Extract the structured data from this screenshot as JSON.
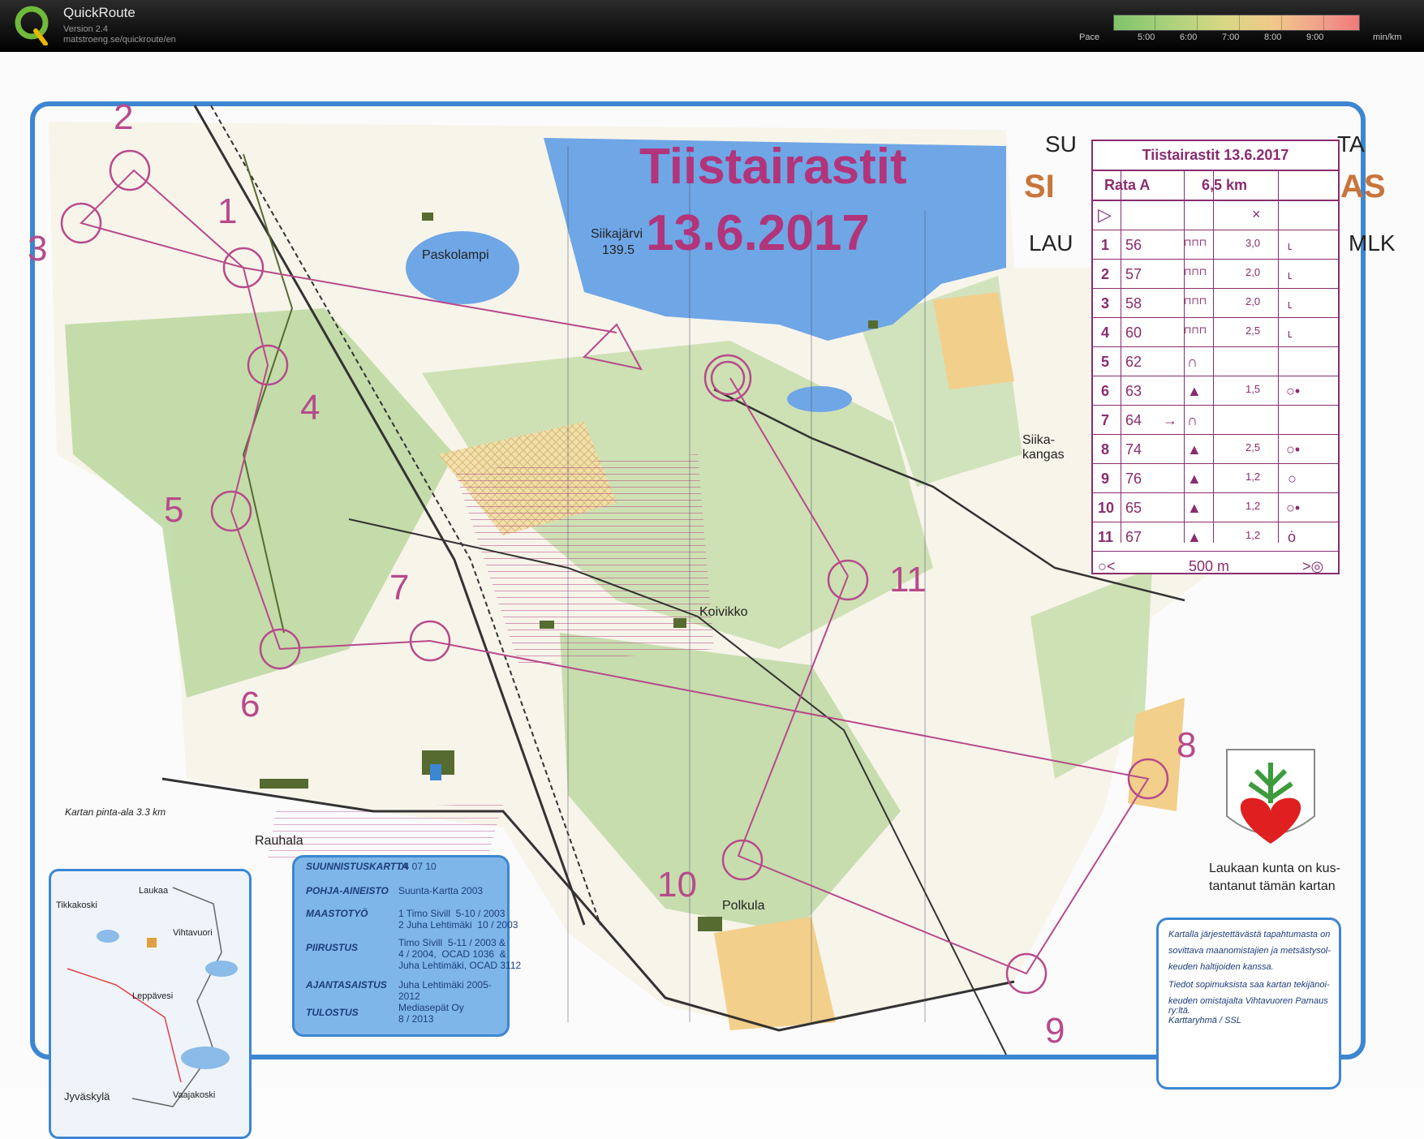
{
  "app": {
    "name": "QuickRoute",
    "version": "Version 2.4",
    "url": "matstroeng.se/quickroute/en"
  },
  "pace_legend": {
    "label": "Pace",
    "ticks": [
      "5:00",
      "6:00",
      "7:00",
      "8:00",
      "9:00"
    ],
    "unit": "min/km"
  },
  "map": {
    "title_line1": "Tiistairastit",
    "title_line2": "13.6.2017",
    "banner_partial_top": "SU",
    "banner_partial_top_right": "TA",
    "banner_partial_mid": "SI",
    "banner_partial_mid_right": "AS",
    "banner_partial_bottom": "LAU",
    "banner_partial_bottom_right": "MLK",
    "control_numbers": [
      "1",
      "2",
      "3",
      "4",
      "5",
      "6",
      "7",
      "8",
      "9",
      "10",
      "11"
    ],
    "place_names": {
      "paskolampi": "Paskolampi",
      "siikajarvi": "Siikajärvi",
      "siikajarvi_height": "139.5",
      "koivikko": "Koivikko",
      "polkula": "Polkula",
      "rauhala": "Rauhala",
      "siikakangas": "Siika-\nkangas"
    }
  },
  "control_description": {
    "title": "Tiistairastit 13.6.2017",
    "course": "Rata A",
    "length": "6,5 km",
    "rows": [
      {
        "n": "1",
        "code": "56",
        "size": "3,0"
      },
      {
        "n": "2",
        "code": "57",
        "size": "2,0"
      },
      {
        "n": "3",
        "code": "58",
        "size": "2,0"
      },
      {
        "n": "4",
        "code": "60",
        "size": "2,5"
      },
      {
        "n": "5",
        "code": "62",
        "size": ""
      },
      {
        "n": "6",
        "code": "63",
        "size": "1,5"
      },
      {
        "n": "7",
        "code": "64",
        "size": ""
      },
      {
        "n": "8",
        "code": "74",
        "size": "2,5"
      },
      {
        "n": "9",
        "code": "76",
        "size": "1,2"
      },
      {
        "n": "10",
        "code": "65",
        "size": "1,2"
      },
      {
        "n": "11",
        "code": "67",
        "size": "1,2"
      }
    ],
    "finish": "500 m"
  },
  "credits": {
    "title_key": "SUUNNISTUSKARTTA",
    "title_val": "04 07 10",
    "rows": [
      {
        "key": "POHJA-AINEISTO",
        "val": "Suunta-Kartta  2003"
      },
      {
        "key": "MAASTOTYÖ",
        "val": "1 Timo Sivill  5-10 / 2003\n2 Juha Lehtimäki  10 / 2003"
      },
      {
        "key": "PIIRUSTUS",
        "val": "Timo Sivill  5-11 / 2003 &\n4 / 2004,  OCAD 1036  &\nJuha Lehtimäki, OCAD 3112"
      },
      {
        "key": "AJANTASAISTUS",
        "val": "Juha Lehtimäki  2005-2012"
      },
      {
        "key": "TULOSTUS",
        "val": "Mediasepät Oy\n8 / 2013"
      }
    ]
  },
  "inset": {
    "caption": "Kartan pinta-ala 3.3 km",
    "places": [
      "Laukaa",
      "Tikkakoski",
      "Vihtavuori",
      "Leppävesi",
      "Jyväskylä",
      "Vaajakoski"
    ]
  },
  "sponsor": {
    "line1": "Laukaan kunta on kus-",
    "line2": "tantanut tämän kartan"
  },
  "note": {
    "lines": [
      "Kartalla järjestettävästä tapahtumasta on",
      "sovittava maanomistajien ja metsästysol-",
      "keuden haltijoiden kanssa.",
      "Tiedot sopimuksista saa kartan tekijänoi-",
      "keuden omistajalta Vihtavuoren Pamaus ry:ltä.",
      "Karttaryhmä / SSL"
    ]
  },
  "colors": {
    "course": "#b74a8b",
    "water": "#6fa6e6",
    "forest_green": "#b7d69a",
    "open_yellow": "#f2cf8a",
    "frame_blue": "#3d86d2"
  }
}
